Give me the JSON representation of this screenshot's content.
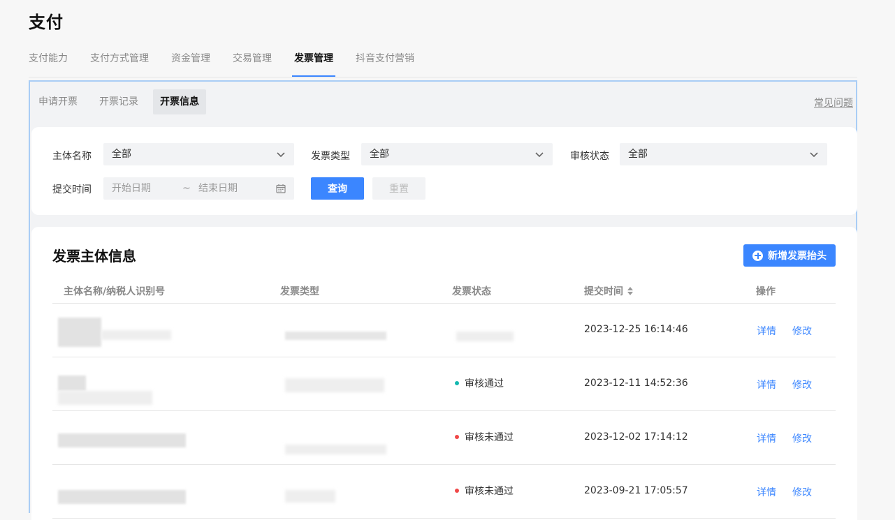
{
  "page": {
    "title": "支付"
  },
  "main_tabs": [
    {
      "label": "支付能力",
      "active": false
    },
    {
      "label": "支付方式管理",
      "active": false
    },
    {
      "label": "资金管理",
      "active": false
    },
    {
      "label": "交易管理",
      "active": false
    },
    {
      "label": "发票管理",
      "active": true
    },
    {
      "label": "抖音支付营销",
      "active": false
    }
  ],
  "sub_tabs": [
    {
      "label": "申请开票",
      "active": false
    },
    {
      "label": "开票记录",
      "active": false
    },
    {
      "label": "开票信息",
      "active": true
    }
  ],
  "faq_link": "常见问题",
  "filters": {
    "entity_name": {
      "label": "主体名称",
      "value": "全部"
    },
    "invoice_type": {
      "label": "发票类型",
      "value": "全部"
    },
    "review_status": {
      "label": "审核状态",
      "value": "全部"
    },
    "submit_time": {
      "label": "提交时间",
      "start_placeholder": "开始日期",
      "separator": "~",
      "end_placeholder": "结束日期"
    },
    "query_button": "查询",
    "reset_button": "重置"
  },
  "list": {
    "title": "发票主体信息",
    "add_button": "新增发票抬头",
    "columns": {
      "name": "主体名称/纳税人识别号",
      "type": "发票类型",
      "status": "发票状态",
      "time": "提交时间",
      "actions": "操作"
    },
    "rows": [
      {
        "status": "",
        "status_color": "",
        "time": "2023-12-25 16:14:46",
        "detail": "详情",
        "edit": "修改"
      },
      {
        "status": "审核通过",
        "status_color": "#14b8b0",
        "time": "2023-12-11 14:52:36",
        "detail": "详情",
        "edit": "修改"
      },
      {
        "status": "审核未通过",
        "status_color": "#f04848",
        "time": "2023-12-02 17:14:12",
        "detail": "详情",
        "edit": "修改"
      },
      {
        "status": "审核未通过",
        "status_color": "#f04848",
        "time": "2023-09-21 17:05:57",
        "detail": "详情",
        "edit": "修改"
      }
    ]
  },
  "colors": {
    "accent": "#3b86ff",
    "frame_border": "#a9cdf5"
  }
}
